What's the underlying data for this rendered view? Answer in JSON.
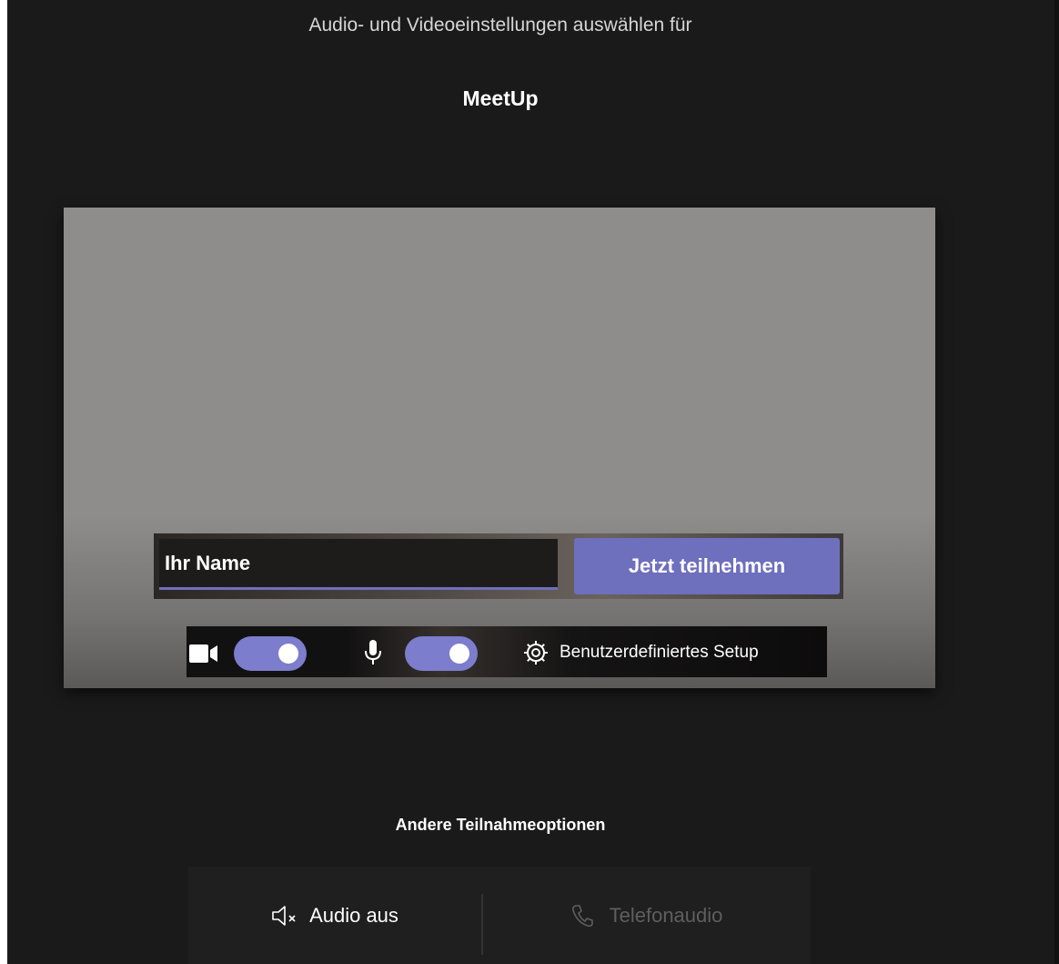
{
  "header": {
    "subtitle": "Audio- und Videoeinstellungen auswählen für",
    "meeting_title": "MeetUp"
  },
  "join_form": {
    "name_placeholder": "Ihr Name",
    "join_button_label": "Jetzt teilnehmen"
  },
  "device_controls": {
    "video_icon": "video-camera-icon",
    "video_enabled": true,
    "mic_icon": "microphone-icon",
    "mic_enabled": true,
    "settings_icon": "gear-icon",
    "custom_setup_label": "Benutzerdefiniertes Setup"
  },
  "other_options": {
    "heading": "Andere Teilnahmeoptionen",
    "options": [
      {
        "icon": "speaker-muted-icon",
        "label": "Audio aus",
        "enabled": true
      },
      {
        "icon": "phone-icon",
        "label": "Telefonaudio",
        "enabled": false
      }
    ]
  },
  "colors": {
    "background": "#1b1a1a",
    "accent": "#6e6fbd",
    "toggle_on": "#7c7dcc",
    "preview_background": "#8e8d8b",
    "disabled_text": "#5e5e5e"
  }
}
